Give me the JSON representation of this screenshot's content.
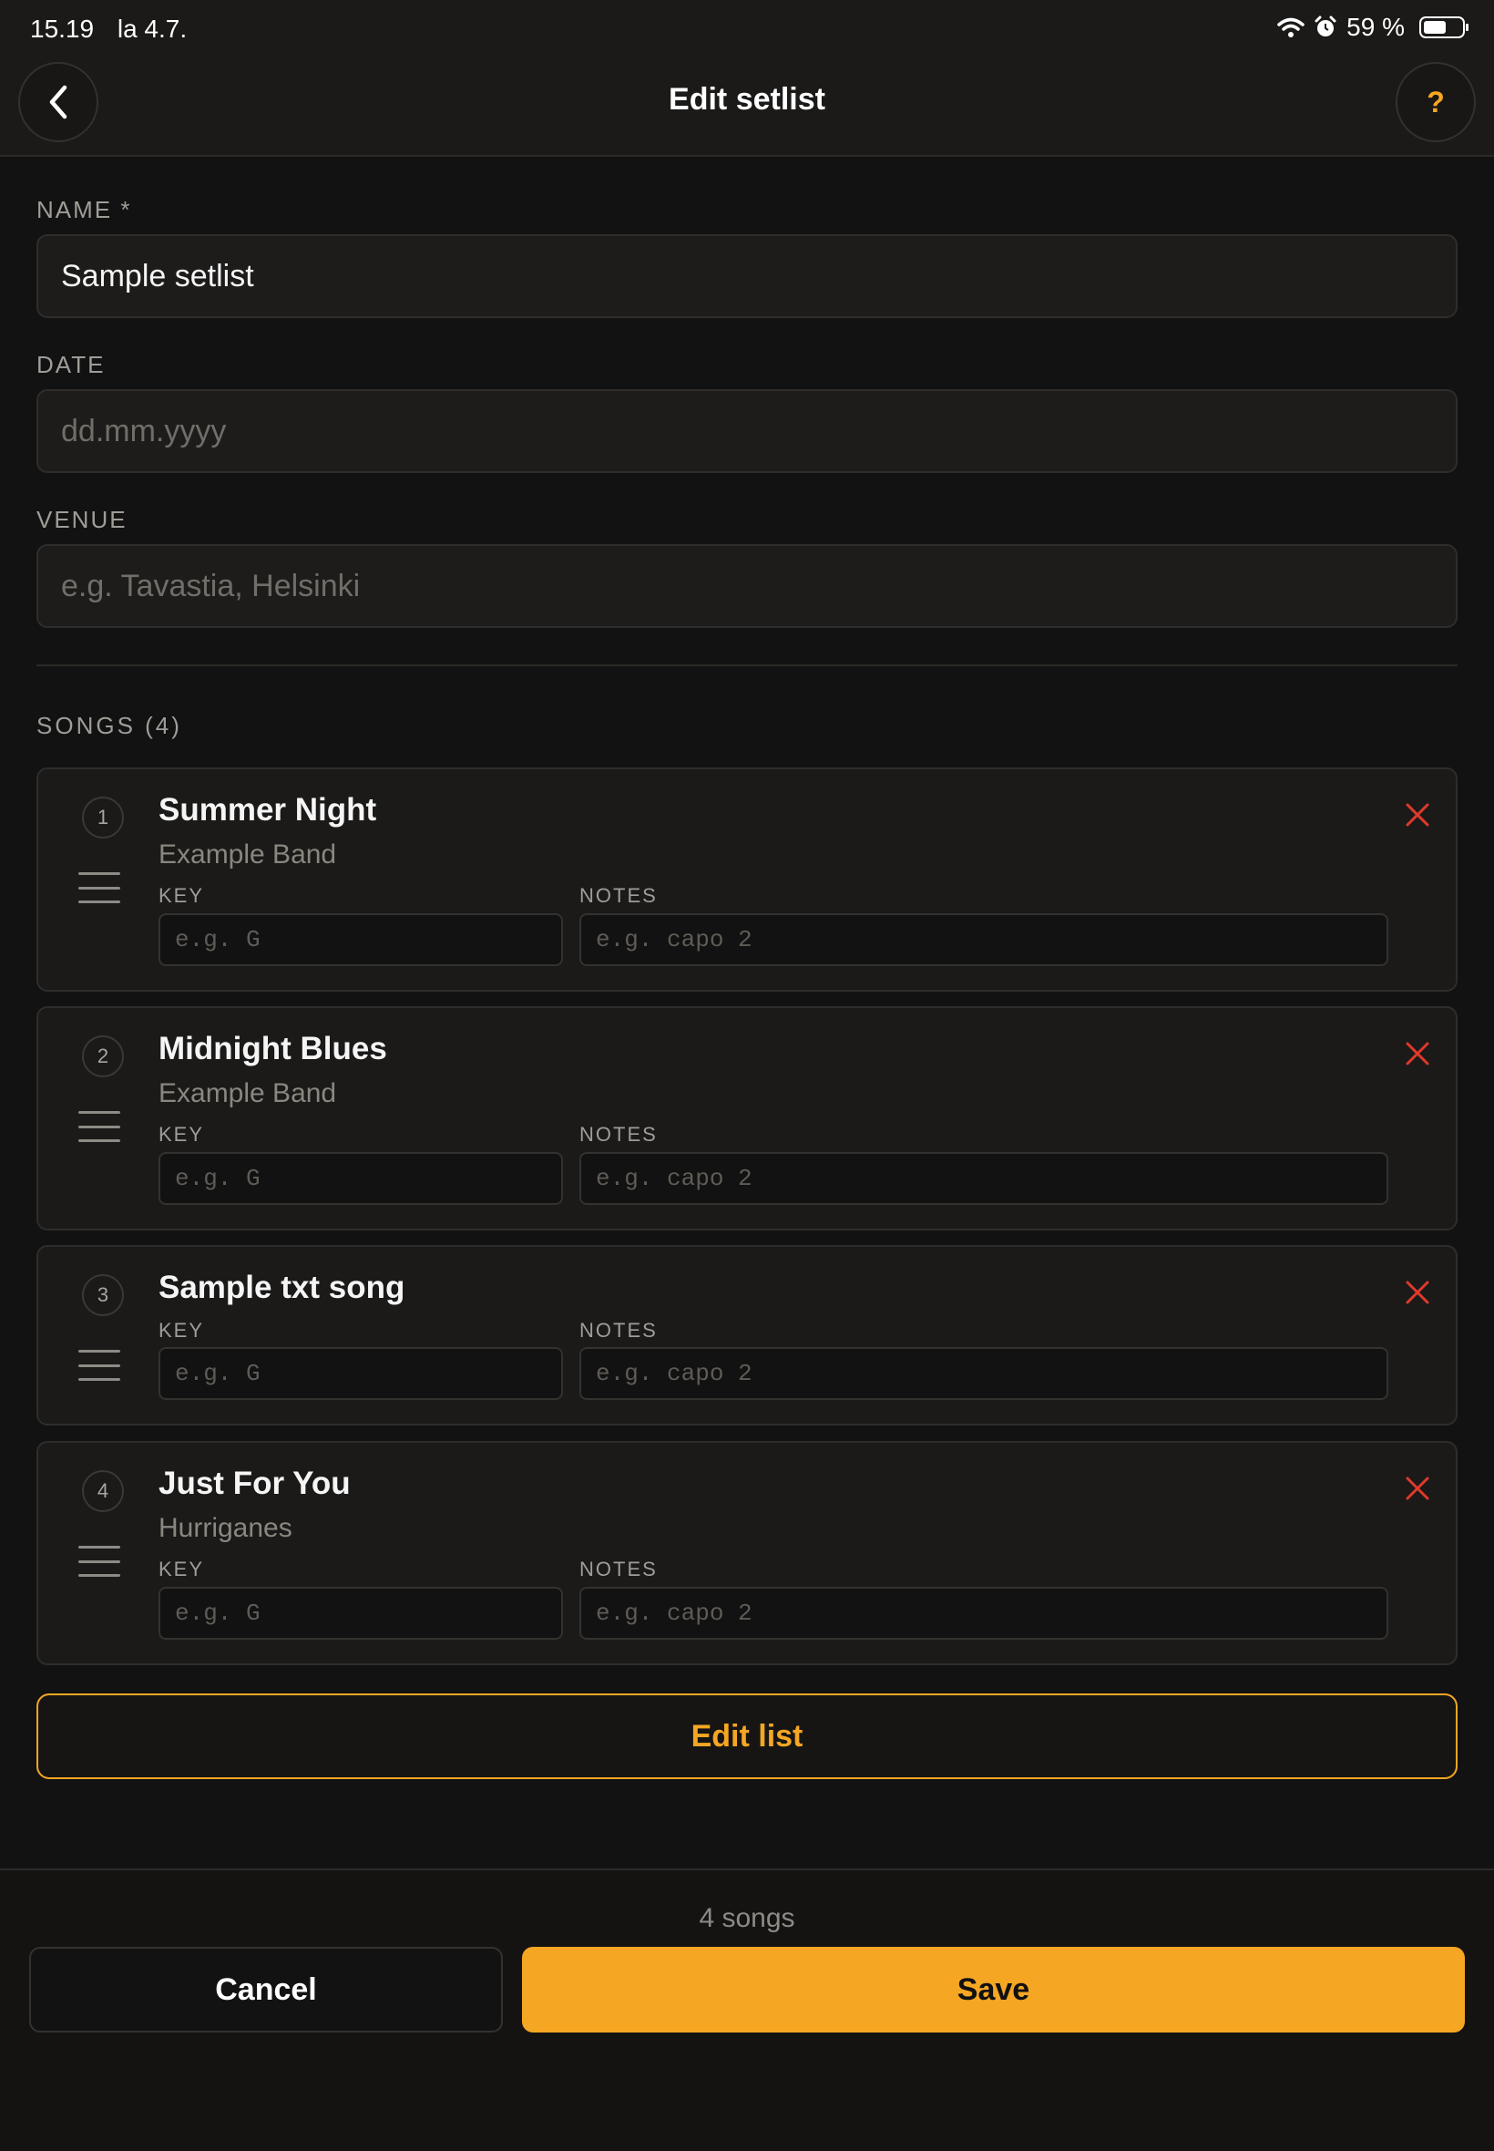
{
  "status_bar": {
    "time": "15.19",
    "date": "la 4.7.",
    "battery_percent": "59 %",
    "battery_level": 0.59,
    "icons": [
      "wifi-icon",
      "alarm-icon",
      "battery-icon"
    ]
  },
  "header": {
    "title": "Edit setlist",
    "back_icon": "chevron-left-icon",
    "help_label": "?"
  },
  "form": {
    "name_label": "NAME *",
    "name_value": "Sample setlist",
    "date_label": "DATE",
    "date_placeholder": "dd.mm.yyyy",
    "venue_label": "VENUE",
    "venue_placeholder": "e.g. Tavastia, Helsinki"
  },
  "songs_section": {
    "label": "SONGS (4)",
    "key_label": "KEY",
    "notes_label": "NOTES",
    "key_placeholder": "e.g. G",
    "notes_placeholder": "e.g. capo 2",
    "songs": [
      {
        "number": "1",
        "title": "Summer Night",
        "artist": "Example Band"
      },
      {
        "number": "2",
        "title": "Midnight Blues",
        "artist": "Example Band"
      },
      {
        "number": "3",
        "title": "Sample txt song",
        "artist": ""
      },
      {
        "number": "4",
        "title": "Just For You",
        "artist": "Hurriganes"
      }
    ]
  },
  "edit_list_label": "Edit list",
  "footer": {
    "count_text": "4 songs",
    "cancel_label": "Cancel",
    "save_label": "Save"
  },
  "colors": {
    "accent": "#f5a623",
    "background": "#121212",
    "remove": "#e0392b"
  }
}
